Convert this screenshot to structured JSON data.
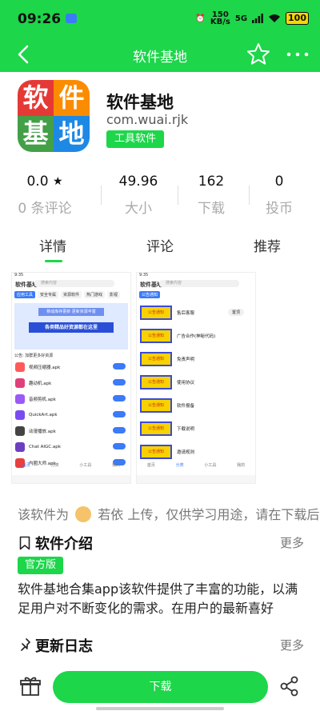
{
  "status_bar": {
    "time": "09:26",
    "net_speed_top": "150",
    "net_speed_bottom": "KB/s",
    "signal": "5G",
    "battery": "100"
  },
  "header": {
    "title": "软件基地",
    "back_icon": "back-arrow-icon",
    "star_icon": "star-outline-icon",
    "more_icon": "more-dots-icon"
  },
  "app": {
    "icon_chars": [
      "软",
      "件",
      "基",
      "地"
    ],
    "name": "软件基地",
    "package": "com.wuai.rjk",
    "category": "工具软件"
  },
  "stats": [
    {
      "value": "0.0",
      "label": "0 条评论",
      "has_star": true
    },
    {
      "value": "49.96",
      "label": "大小"
    },
    {
      "value": "162",
      "label": "下载"
    },
    {
      "value": "0",
      "label": "投币"
    }
  ],
  "tabs": {
    "active": 0,
    "items": [
      "详情",
      "评论",
      "推荐"
    ]
  },
  "screenshots": {
    "left": {
      "status_time": "9:35",
      "title": "软件基地",
      "search_placeholder": "搜索内容",
      "chips": [
        "应用工具",
        "安全专属",
        "资源软件",
        "热门游戏",
        "影视"
      ],
      "banner_top": "移动库存更新 更新资源丰富",
      "banner": "各类精品好资源都在这里",
      "notice": "公告: 加群更多好资源",
      "apps": [
        {
          "name": "视频压缩器.apk",
          "color": "#ff5a5a"
        },
        {
          "name": "趣动机.apk",
          "color": "#e0407a"
        },
        {
          "name": "音频剪机.apk",
          "color": "#9b59f5"
        },
        {
          "name": "QuickArt.apk",
          "color": "#7a4cf0"
        },
        {
          "name": "动漫播放.apk",
          "color": "#444444"
        },
        {
          "name": "Chat AIGC.apk",
          "color": "#6d3fc0"
        },
        {
          "name": "内圈大师.apk",
          "color": "#e83f3f"
        }
      ],
      "nav": [
        "首页",
        "分类",
        "小工具",
        "我的"
      ]
    },
    "right": {
      "status_time": "9:35",
      "title": "软件基地",
      "search_placeholder": "搜索内容",
      "tab": "公告通知",
      "notice_tag": "公告通知",
      "items": [
        "售后客服",
        "广告合作(神秘代码)",
        "免责声明",
        "使用协议",
        "软件报备",
        "下载说明",
        "邀请规则"
      ],
      "pill": "置顶",
      "nav": [
        "首页",
        "分类",
        "小工具",
        "我的"
      ]
    }
  },
  "uploader": {
    "prefix": "该软件为",
    "name": "若依",
    "suffix": "上传，仅供学习用途，请在下载后"
  },
  "intro_section": {
    "title": "软件介绍",
    "more": "更多",
    "badge": "官方版",
    "text": "软件基地合集app该软件提供了丰富的功能，以满足用户对不断变化的需求。在用户的最新喜好"
  },
  "changelog_section": {
    "title": "更新日志",
    "more": "更多"
  },
  "bottom_bar": {
    "download": "下载",
    "gift_icon": "gift-icon",
    "share_icon": "share-icon"
  }
}
